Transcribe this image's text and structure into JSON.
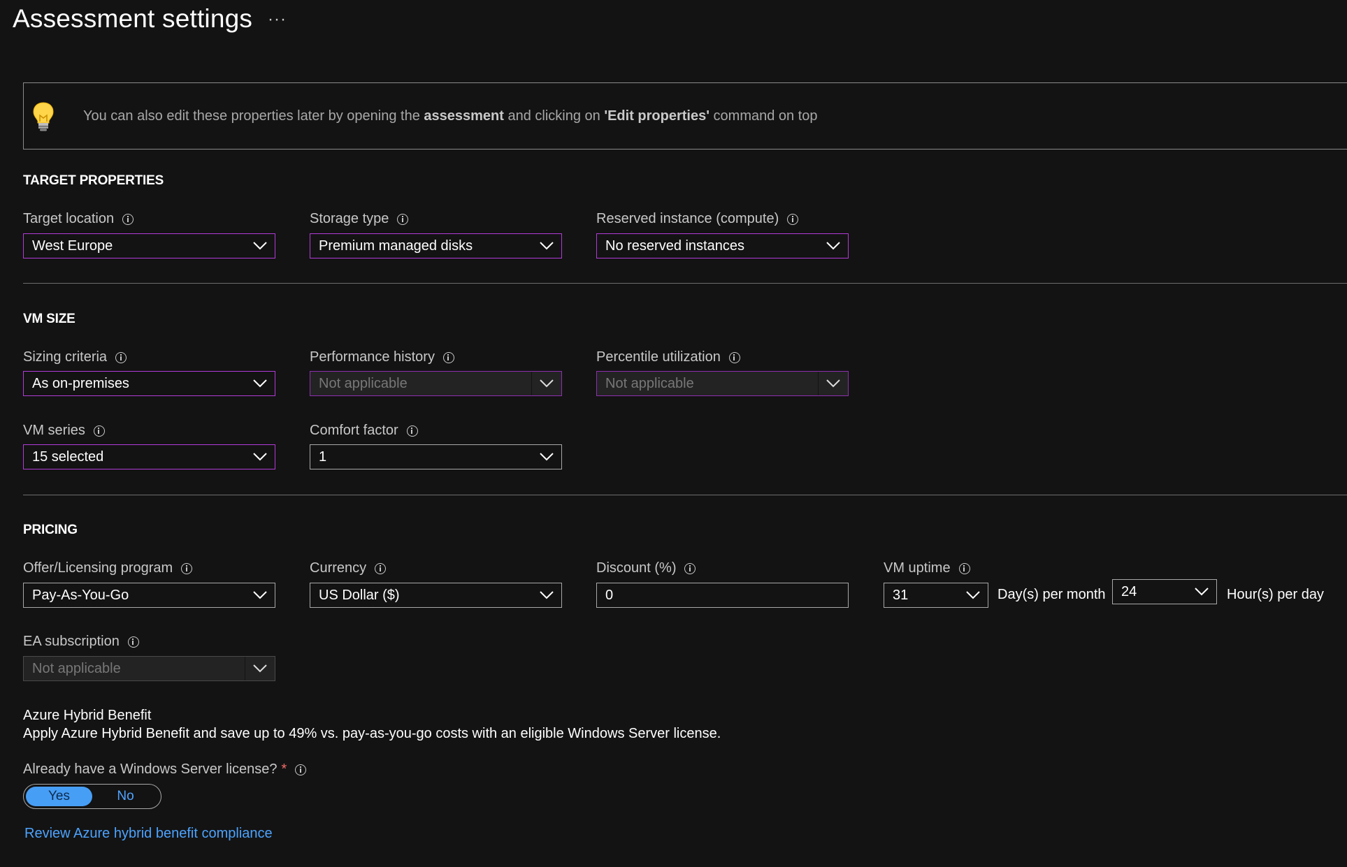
{
  "header": {
    "title": "Assessment settings",
    "more_label": "···"
  },
  "banner": {
    "icon": "lightbulb-icon",
    "text_1": "You can also edit these properties later by opening the ",
    "bold_1": "assessment",
    "text_2": " and clicking on ",
    "bold_2": "'Edit properties'",
    "text_3": " command on top"
  },
  "target": {
    "section_title": "TARGET PROPERTIES",
    "location": {
      "label": "Target location",
      "value": "West Europe"
    },
    "storage": {
      "label": "Storage type",
      "value": "Premium managed disks"
    },
    "reserved": {
      "label": "Reserved instance (compute)",
      "value": "No reserved instances"
    }
  },
  "vmsize": {
    "section_title": "VM SIZE",
    "sizing": {
      "label": "Sizing criteria",
      "value": "As on-premises"
    },
    "perf_history": {
      "label": "Performance history",
      "value": "Not applicable"
    },
    "percentile": {
      "label": "Percentile utilization",
      "value": "Not applicable"
    },
    "series": {
      "label": "VM series",
      "value": "15 selected"
    },
    "comfort": {
      "label": "Comfort factor",
      "value": "1"
    }
  },
  "pricing": {
    "section_title": "PRICING",
    "offer": {
      "label": "Offer/Licensing program",
      "value": "Pay-As-You-Go"
    },
    "currency": {
      "label": "Currency",
      "value": "US Dollar ($)"
    },
    "discount": {
      "label": "Discount (%)",
      "value": "0"
    },
    "uptime": {
      "label": "VM uptime",
      "days_value": "31",
      "days_unit": "Day(s) per month",
      "hours_value": "24",
      "hours_unit": "Hour(s) per day"
    },
    "ea": {
      "label": "EA subscription",
      "value": "Not applicable"
    },
    "ahb_title": "Azure Hybrid Benefit",
    "ahb_desc": "Apply Azure Hybrid Benefit and save up to 49% vs. pay-as-you-go costs with an eligible Windows Server license.",
    "license_q": "Already have a Windows Server license?",
    "required_mark": "*",
    "toggle_yes": "Yes",
    "toggle_no": "No",
    "toggle_selected": "Yes",
    "review_link": "Review Azure hybrid benefit compliance"
  },
  "colors": {
    "background": "#131313",
    "focus_border": "#b23bd8",
    "link": "#4ca3ff",
    "toggle_selected": "#479ef5",
    "required": "#f26b6b"
  }
}
